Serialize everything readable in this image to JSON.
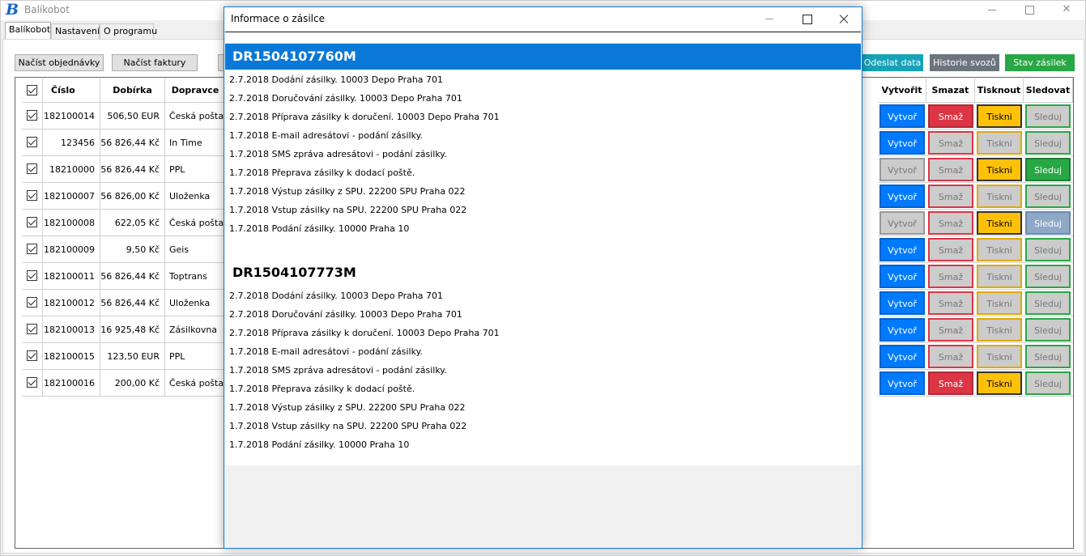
{
  "app": {
    "title": "Balíkobot",
    "logo": "B"
  },
  "tabs": [
    {
      "label": "Balíkobot",
      "active": true
    },
    {
      "label": "Nastavení",
      "active": false
    },
    {
      "label": "O programu",
      "active": false
    }
  ],
  "toolbar": {
    "load_orders": "Načíst objednávky",
    "load_invoices": "Načíst faktury",
    "send_data": "Odeslat data",
    "history": "Historie svozů",
    "status": "Stav zásilek"
  },
  "colors": {
    "send_data": "#17a2b8",
    "history": "#6c757d",
    "status": "#28a745",
    "create": "#007bff",
    "delete": "#dc3545",
    "print": "#ffc107",
    "track": "#28a745",
    "track_light": "#8fa8c8",
    "disabled": "#cccccc"
  },
  "grid": {
    "headers": {
      "cislo": "Číslo",
      "dobirka": "Dobírka",
      "dopravce": "Dopravce",
      "vytvorit": "Vytvořit",
      "smazat": "Smazat",
      "tisknout": "Tisknout",
      "sledovat": "Sledovat"
    },
    "action_labels": {
      "create": "Vytvoř",
      "delete": "Smaž",
      "print": "Tiskni",
      "track": "Sleduj"
    },
    "rows": [
      {
        "cislo": "182100014",
        "dobirka": "506,50 EUR",
        "dopravce": "Česká pošta",
        "create": "enabled",
        "delete": "enabled",
        "print": "enabled",
        "track": "disabled"
      },
      {
        "cislo": "123456",
        "dobirka": "56 826,44 Kč",
        "dopravce": "In Time",
        "create": "enabled",
        "delete": "disabled",
        "print": "disabled",
        "track": "disabled"
      },
      {
        "cislo": "18210000",
        "dobirka": "56 826,44 Kč",
        "dopravce": "PPL",
        "create": "disabled",
        "delete": "disabled",
        "print": "enabled",
        "track": "enabled"
      },
      {
        "cislo": "182100007",
        "dobirka": "56 826,00 Kč",
        "dopravce": "Uloženka",
        "create": "enabled",
        "delete": "disabled",
        "print": "disabled",
        "track": "disabled"
      },
      {
        "cislo": "182100008",
        "dobirka": "622,05 Kč",
        "dopravce": "Česká pošta",
        "create": "disabled",
        "delete": "disabled",
        "print": "enabled",
        "track": "light"
      },
      {
        "cislo": "182100009",
        "dobirka": "9,50 Kč",
        "dopravce": "Geis",
        "create": "enabled",
        "delete": "disabled",
        "print": "disabled",
        "track": "disabled"
      },
      {
        "cislo": "182100011",
        "dobirka": "56 826,44 Kč",
        "dopravce": "Toptrans",
        "create": "enabled",
        "delete": "disabled",
        "print": "disabled",
        "track": "disabled"
      },
      {
        "cislo": "182100012",
        "dobirka": "56 826,44 Kč",
        "dopravce": "Uloženka",
        "create": "enabled",
        "delete": "disabled",
        "print": "disabled",
        "track": "disabled"
      },
      {
        "cislo": "182100013",
        "dobirka": "16 925,48 Kč",
        "dopravce": "Zásilkovna",
        "create": "enabled",
        "delete": "disabled",
        "print": "disabled",
        "track": "disabled"
      },
      {
        "cislo": "182100015",
        "dobirka": "123,50 EUR",
        "dopravce": "PPL",
        "create": "enabled",
        "delete": "disabled",
        "print": "disabled",
        "track": "disabled"
      },
      {
        "cislo": "182100016",
        "dobirka": "200,00 Kč",
        "dopravce": "Česká pošta",
        "create": "enabled",
        "delete": "enabled",
        "print": "enabled",
        "track": "disabled"
      }
    ]
  },
  "dialog": {
    "title": "Informace o zásilce",
    "packages": [
      {
        "id": "DR1504107760M",
        "events": [
          "2.7.2018 Dodání zásilky. 10003 Depo Praha 701",
          "2.7.2018 Doručování zásilky. 10003 Depo Praha 701",
          "2.7.2018 Příprava zásilky k doručení. 10003 Depo Praha 701",
          "1.7.2018 E-mail adresátovi - podání zásilky.",
          "1.7.2018 SMS zpráva adresátovi - podání zásilky.",
          "1.7.2018 Přeprava zásilky k dodací poště.",
          "1.7.2018 Výstup zásilky z SPU. 22200 SPU Praha 022",
          "1.7.2018 Vstup zásilky na SPU. 22200 SPU Praha 022",
          "1.7.2018 Podání zásilky. 10000 Praha 10"
        ]
      },
      {
        "id": "DR1504107773M",
        "events": [
          "2.7.2018 Dodání zásilky. 10003 Depo Praha 701",
          "2.7.2018 Doručování zásilky. 10003 Depo Praha 701",
          "2.7.2018 Příprava zásilky k doručení. 10003 Depo Praha 701",
          "1.7.2018 E-mail adresátovi - podání zásilky.",
          "1.7.2018 SMS zpráva adresátovi - podání zásilky.",
          "1.7.2018 Přeprava zásilky k dodací poště.",
          "1.7.2018 Výstup zásilky z SPU. 22200 SPU Praha 022",
          "1.7.2018 Vstup zásilky na SPU. 22200 SPU Praha 022",
          "1.7.2018 Podání zásilky. 10000 Praha 10"
        ]
      }
    ]
  }
}
